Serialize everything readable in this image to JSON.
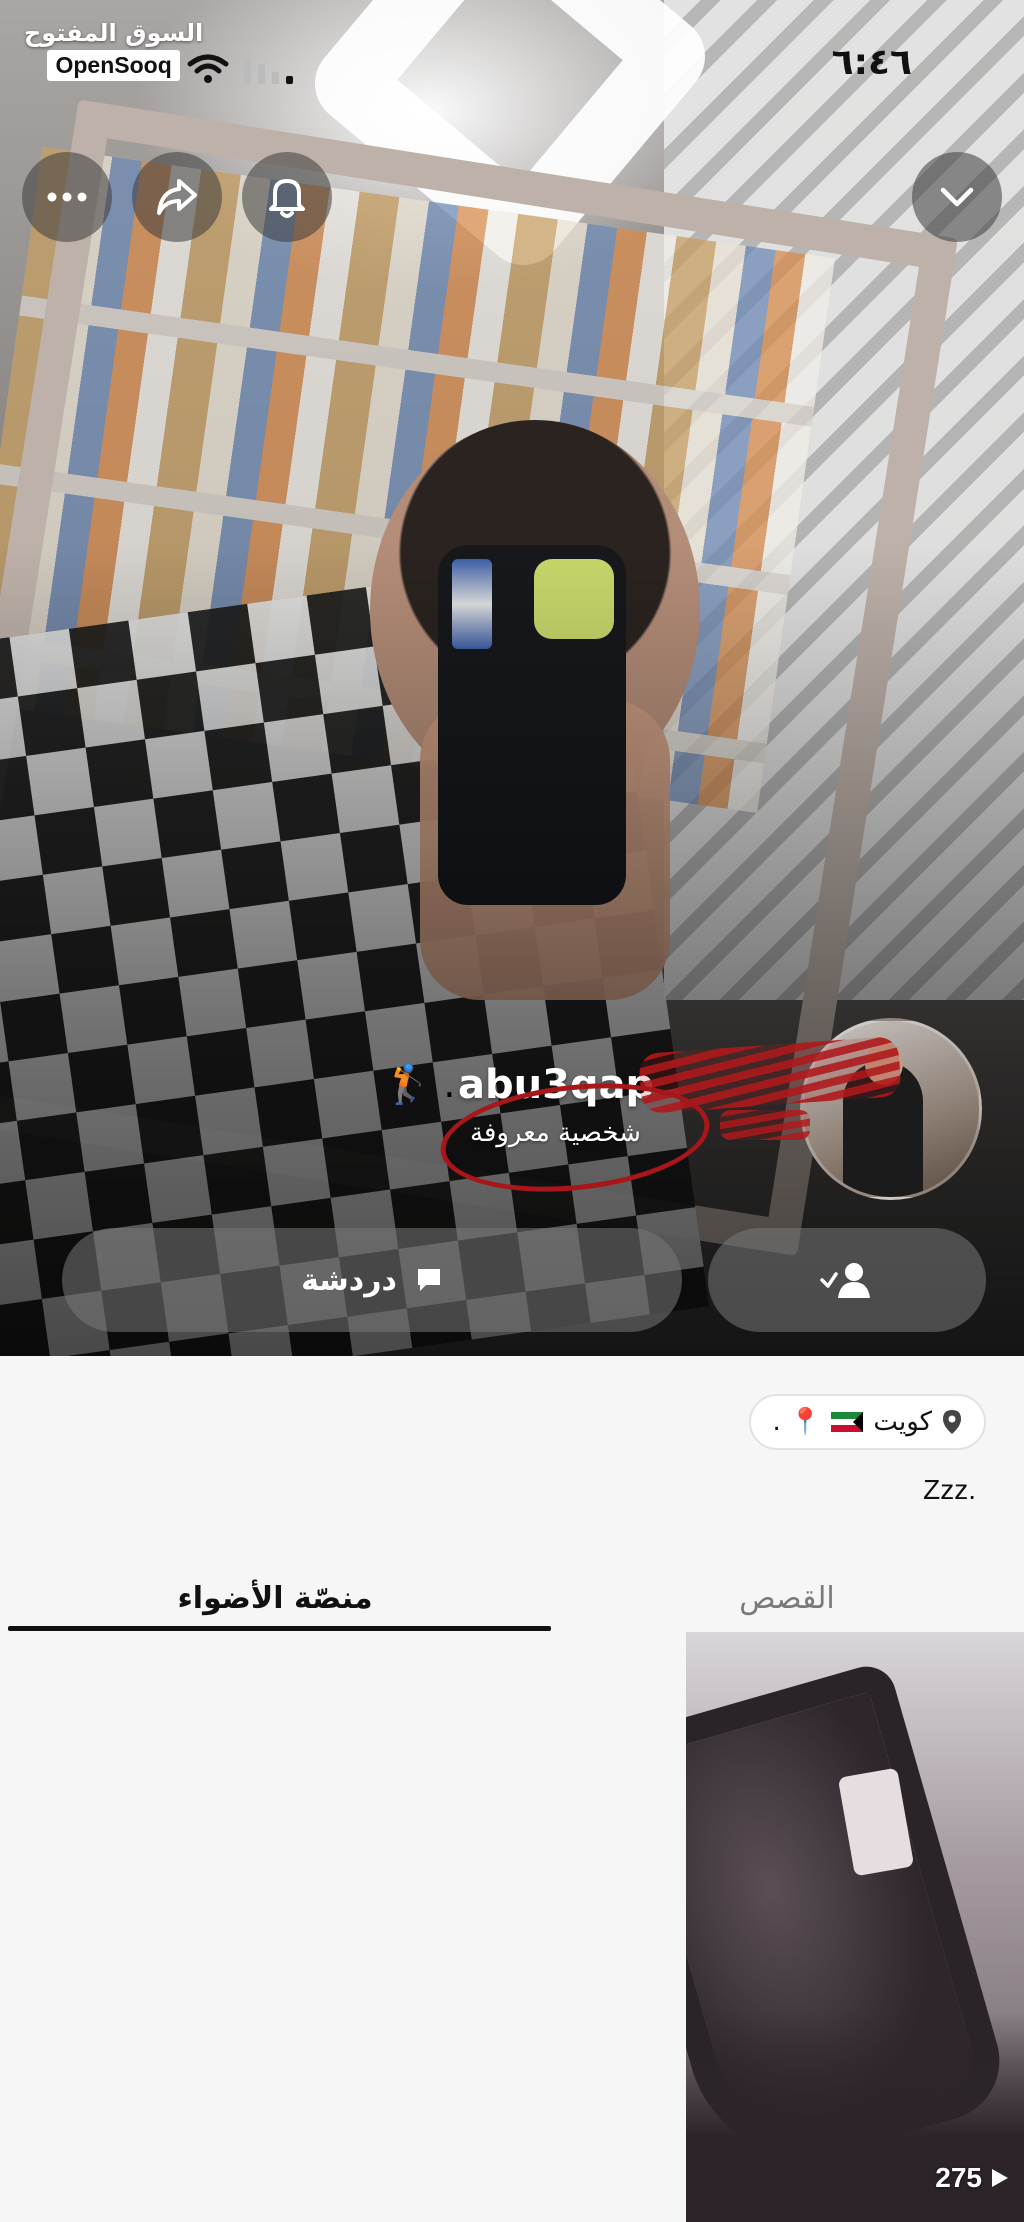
{
  "status_bar": {
    "brand_ar": "السوق المفتوح",
    "brand_en": "OpenSooq",
    "time": "٦:٤٦"
  },
  "top_actions": {
    "more_icon": "ellipsis-icon",
    "share_icon": "share-arrow-icon",
    "notify_icon": "bell-icon",
    "collapse_icon": "chevron-down-icon"
  },
  "profile": {
    "username": "abu3qap",
    "username_prefix_emoji": "🏌️ .",
    "subtitle": "شخصية معروفة",
    "chat_label": "دردشة",
    "chat_icon": "chat-bubble-icon",
    "friend_icon": "friend-added-icon"
  },
  "details": {
    "location_text": "كويت",
    "location_extra": "📍 .",
    "bio": "Zzz."
  },
  "tabs": {
    "stories": "القصص",
    "spotlight": "منصّة الأضواء"
  },
  "grid": {
    "tiles": [
      {
        "views": "275"
      }
    ]
  },
  "colors": {
    "accent_dark": "#111111",
    "tab_inactive": "#7a7a7a",
    "background": "#f6f6f6",
    "redaction": "#b0181b"
  }
}
